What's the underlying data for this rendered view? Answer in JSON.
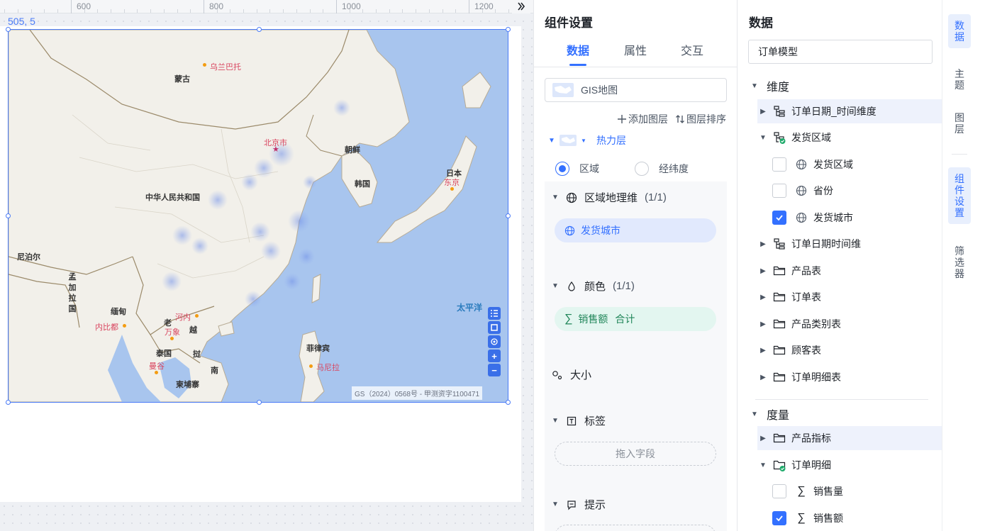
{
  "ruler": {
    "labels": [
      "600",
      "800",
      "1000",
      "1200"
    ]
  },
  "canvas": {
    "coordinate_readout": "505, 5"
  },
  "map": {
    "countries": [
      "蒙古",
      "中华人民共和国",
      "朝鲜",
      "韩国",
      "日本",
      "尼泊尔",
      "缅甸",
      "老",
      "泰国",
      "越",
      "挝",
      "南",
      "柬埔寨",
      "菲律宾"
    ],
    "bangladesh": [
      "孟",
      "加",
      "拉",
      "国"
    ],
    "cities": [
      "乌兰巴托",
      "北京市",
      "东京",
      "河内",
      "万象",
      "内比都",
      "曼谷",
      "马尼拉"
    ],
    "ocean": "太平洋",
    "copyright": "GS（2024）0568号 - 甲测资字1100471"
  },
  "settings": {
    "title": "组件设置",
    "tabs": [
      "数据",
      "属性",
      "交互"
    ],
    "active_tab": "数据",
    "chart_type": "GIS地图",
    "add_layer": "添加图层",
    "sort_layers": "图层排序",
    "layer_name": "热力层",
    "mode_options": [
      "区域",
      "经纬度"
    ],
    "selected_mode": "区域",
    "shelves": {
      "geo": {
        "label": "区域地理维",
        "count": "(1/1)",
        "field": "发货城市"
      },
      "color": {
        "label": "颜色",
        "count": "(1/1)",
        "field": "销售额",
        "agg": "合计"
      },
      "size": {
        "label": "大小"
      },
      "label": {
        "label": "标签",
        "placeholder": "拖入字段"
      },
      "tooltip": {
        "label": "提示"
      }
    }
  },
  "data_panel": {
    "title": "数据",
    "model": "订单模型",
    "dimension_header": "维度",
    "measure_header": "度量",
    "dimensions": [
      {
        "label": "订单日期_时间维度",
        "type": "hierarchy",
        "expanded": false,
        "level": 0
      },
      {
        "label": "发货区域",
        "type": "hierarchy-check",
        "expanded": true,
        "level": 0
      },
      {
        "label": "发货区域",
        "type": "geo",
        "checked": false,
        "level": 1
      },
      {
        "label": "省份",
        "type": "geo",
        "checked": false,
        "level": 1
      },
      {
        "label": "发货城市",
        "type": "geo",
        "checked": true,
        "level": 1
      },
      {
        "label": "订单日期时间维",
        "type": "hierarchy",
        "expanded": false,
        "level": 0
      },
      {
        "label": "产品表",
        "type": "folder",
        "expanded": false,
        "level": 0
      },
      {
        "label": "订单表",
        "type": "folder",
        "expanded": false,
        "level": 0
      },
      {
        "label": "产品类别表",
        "type": "folder",
        "expanded": false,
        "level": 0
      },
      {
        "label": "顾客表",
        "type": "folder",
        "expanded": false,
        "level": 0
      },
      {
        "label": "订单明细表",
        "type": "folder",
        "expanded": false,
        "level": 0
      }
    ],
    "measures": [
      {
        "label": "产品指标",
        "type": "folder",
        "expanded": false,
        "level": 0
      },
      {
        "label": "订单明细",
        "type": "folder-check",
        "expanded": true,
        "level": 0
      },
      {
        "label": "销售量",
        "type": "sum",
        "checked": false,
        "level": 1
      },
      {
        "label": "销售额",
        "type": "sum",
        "checked": true,
        "level": 1
      }
    ]
  },
  "rail": {
    "items": [
      "数据",
      "主题",
      "图层",
      "组件设置",
      "筛选器"
    ],
    "active": [
      "数据",
      "组件设置"
    ]
  },
  "colors": {
    "accent": "#3370ff",
    "selection": "#4a7bf7",
    "ocean": "#a8c5ee",
    "land": "#f2f0ea"
  }
}
